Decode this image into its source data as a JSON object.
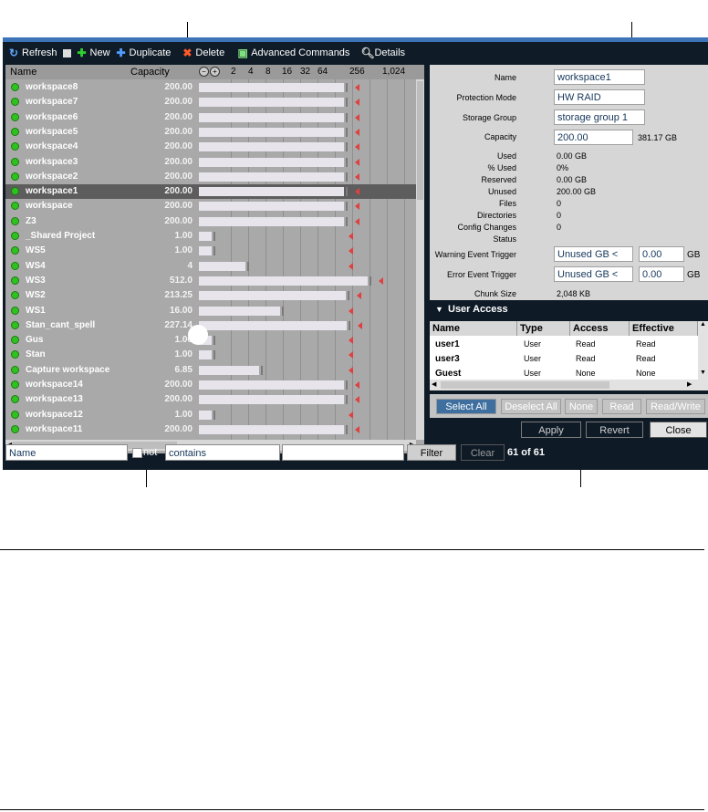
{
  "toolbar": {
    "refresh": "Refresh",
    "new": "New",
    "duplicate": "Duplicate",
    "delete": "Delete",
    "advanced": "Advanced Commands",
    "details": "Details"
  },
  "list": {
    "col_name": "Name",
    "col_capacity": "Capacity",
    "scale": [
      "2",
      "4",
      "8",
      "16",
      "32",
      "64",
      "256",
      "1,024"
    ],
    "rows": [
      {
        "name": "workspace8",
        "capacity": "200.00",
        "used_fraction": 0.99
      },
      {
        "name": "workspace7",
        "capacity": "200.00",
        "used_fraction": 0.99
      },
      {
        "name": "workspace6",
        "capacity": "200.00",
        "used_fraction": 0.99
      },
      {
        "name": "workspace5",
        "capacity": "200.00",
        "used_fraction": 0.99
      },
      {
        "name": "workspace4",
        "capacity": "200.00",
        "used_fraction": 0.99
      },
      {
        "name": "workspace3",
        "capacity": "200.00",
        "used_fraction": 0.99
      },
      {
        "name": "workspace2",
        "capacity": "200.00",
        "used_fraction": 0.99
      },
      {
        "name": "workspace1",
        "capacity": "200.00",
        "used_fraction": 0.99,
        "selected": true
      },
      {
        "name": "workspace",
        "capacity": "200.00",
        "used_fraction": 0.99
      },
      {
        "name": "Z3",
        "capacity": "200.00",
        "used_fraction": 0.99
      },
      {
        "name": "_Shared Project",
        "capacity": "1.00",
        "used_fraction": 0.99
      },
      {
        "name": "WS5",
        "capacity": "1.00",
        "used_fraction": 0.99
      },
      {
        "name": "WS4",
        "capacity": "4",
        "used_fraction": 0.99
      },
      {
        "name": "WS3",
        "capacity": "512.0",
        "used_fraction": 0.99
      },
      {
        "name": "WS2",
        "capacity": "213.25",
        "used_fraction": 0.99
      },
      {
        "name": "WS1",
        "capacity": "16.00",
        "used_fraction": 0.99
      },
      {
        "name": "Stan_cant_spell",
        "capacity": "227.14",
        "used_fraction": 0.99
      },
      {
        "name": "Gus",
        "capacity": "1.00",
        "used_fraction": 0.99
      },
      {
        "name": "Stan",
        "capacity": "1.00",
        "used_fraction": 0.99
      },
      {
        "name": "Capture workspace",
        "capacity": "6.85",
        "used_fraction": 0.99
      },
      {
        "name": "workspace14",
        "capacity": "200.00",
        "used_fraction": 0.99
      },
      {
        "name": "workspace13",
        "capacity": "200.00",
        "used_fraction": 0.99
      },
      {
        "name": "workspace12",
        "capacity": "1.00",
        "used_fraction": 0.99
      },
      {
        "name": "workspace11",
        "capacity": "200.00",
        "used_fraction": 0.99
      }
    ]
  },
  "details": {
    "name_label": "Name",
    "name_value": "workspace1",
    "protection_label": "Protection Mode",
    "protection_value": "HW RAID",
    "group_label": "Storage Group",
    "group_value": "storage group 1",
    "capacity_label": "Capacity",
    "capacity_value": "200.00",
    "capacity_max": "381.17 GB",
    "used_label": "Used",
    "used_value": "0.00 GB",
    "pct_used_label": "% Used",
    "pct_used_value": "0%",
    "reserved_label": "Reserved",
    "reserved_value": "0.00 GB",
    "unused_label": "Unused",
    "unused_value": "200.00 GB",
    "files_label": "Files",
    "files_value": "0",
    "dirs_label": "Directories",
    "dirs_value": "0",
    "config_label": "Config Changes",
    "config_value": "0",
    "status_label": "Status",
    "warn_label": "Warning Event Trigger",
    "warn_mode": "Unused GB <",
    "warn_value": "0.00",
    "warn_unit": "GB",
    "error_label": "Error Event Trigger",
    "error_mode": "Unused GB <",
    "error_value": "0.00",
    "error_unit": "GB",
    "chunk_label": "Chunk Size",
    "chunk_value": "2,048 KB"
  },
  "user_access": {
    "title": "User Access",
    "columns": [
      "Name",
      "Type",
      "Access",
      "Effective"
    ],
    "rows": [
      {
        "name": "user1",
        "type": "User",
        "access": "Read",
        "effective": "Read"
      },
      {
        "name": "user3",
        "type": "User",
        "access": "Read",
        "effective": "Read"
      },
      {
        "name": "Guest",
        "type": "User",
        "access": "None",
        "effective": "None"
      }
    ],
    "select_all": "Select All",
    "deselect_all": "Deselect All",
    "none": "None",
    "read": "Read",
    "read_write": "Read/Write"
  },
  "actions": {
    "apply": "Apply",
    "revert": "Revert",
    "close": "Close"
  },
  "filter": {
    "field": "Name",
    "not_label": "not",
    "operator": "contains",
    "value": "",
    "filter_button": "Filter",
    "clear_button": "Clear",
    "count": "61 of 61"
  }
}
